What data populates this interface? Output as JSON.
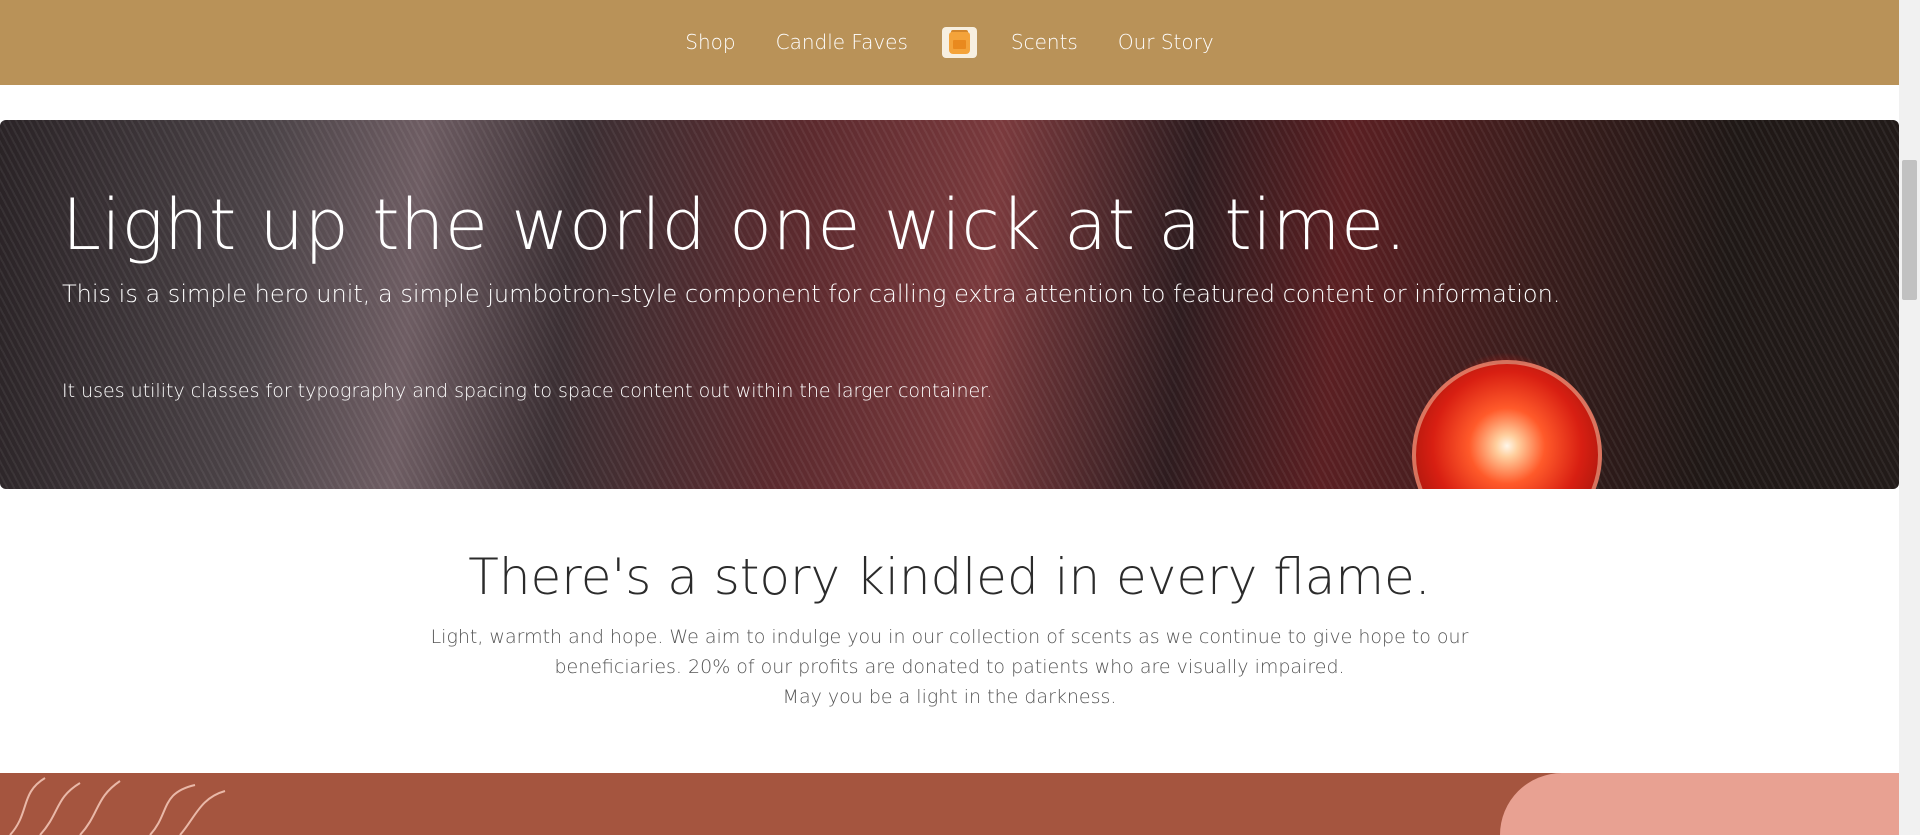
{
  "nav": {
    "items": [
      {
        "label": "Shop"
      },
      {
        "label": "Candle Faves"
      },
      {
        "label": "Scents"
      },
      {
        "label": "Our Story"
      }
    ],
    "logo_icon": "candle-jar-icon"
  },
  "hero": {
    "title": "Light up the world one wick at a time.",
    "lead": "This is a simple hero unit, a simple jumbotron-style component for calling extra attention to featured content or information.",
    "sub": "It uses utility classes for typography and spacing to space content out within the larger container."
  },
  "story": {
    "title": "There's a story kindled in every flame.",
    "lines": [
      "Light, warmth and hope. We aim to indulge you in our collection of scents as we continue to give hope to our beneficiaries. 20% of our profits are donated to patients who are visually impaired.",
      "May you be a light in the darkness."
    ]
  },
  "colors": {
    "navbar": "#b99258",
    "footer_band": "#a5553f",
    "footer_accent": "#e8a192"
  }
}
